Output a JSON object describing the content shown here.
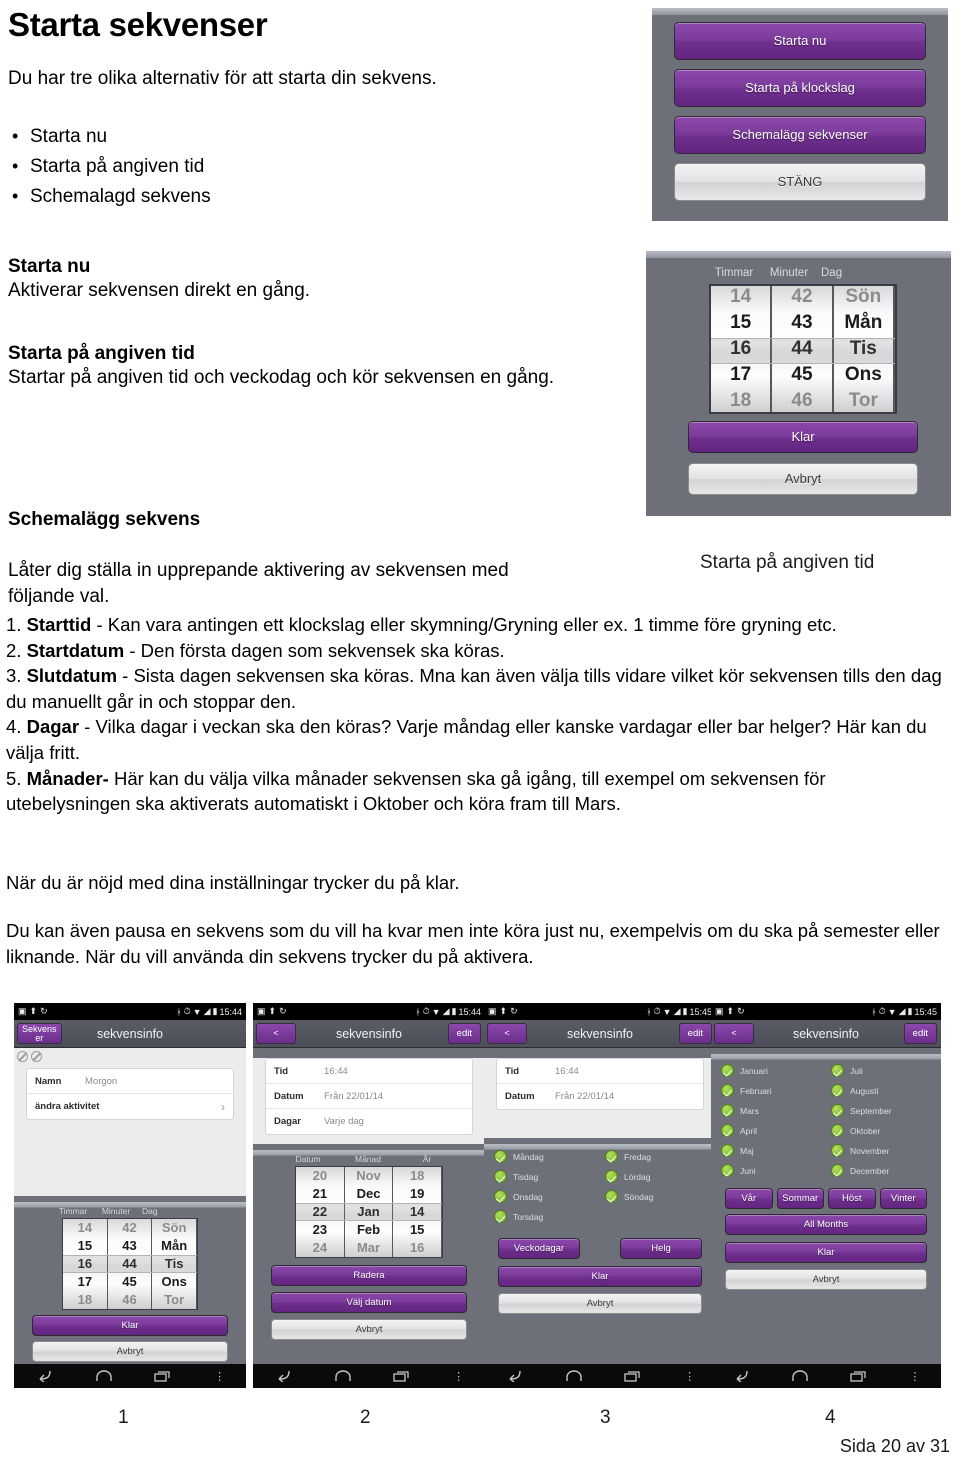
{
  "document": {
    "title": "Starta sekvenser",
    "intro": "Du har tre olika alternativ för att starta din sekvens.",
    "bullets": [
      "Starta nu",
      "Starta på angiven tid",
      "Schemalagd sekvens"
    ],
    "sections": [
      {
        "title": "Starta nu",
        "body": "Aktiverar sekvensen direkt en gång."
      },
      {
        "title": "Starta på angiven tid",
        "body": "Startar på angiven tid och veckodag och kör sekvensen en gång."
      },
      {
        "title": "Schemalägg sekvens",
        "body": "Låter dig ställa in upprepande aktivering av sekvensen med följande val."
      }
    ],
    "numbered": [
      {
        "n": "1.",
        "term": "Starttid",
        "text": " - Kan vara antingen ett klockslag eller skymning/Gryning eller ex. 1 timme före gryning etc."
      },
      {
        "n": "2.",
        "term": "Startdatum",
        "text": " - Den första dagen som sekvensek ska köras."
      },
      {
        "n": "3.",
        "term": "Slutdatum",
        "text": " - Sista dagen sekvensen ska köras. Mna kan även välja tills vidare vilket kör sekvensen tills den dag du manuellt går in och stoppar den."
      },
      {
        "n": "4.",
        "term": "Dagar",
        "text": " - Vilka dagar i veckan ska den köras? Varje måndag eller kanske vardagar eller bar helger? Här kan du välja fritt."
      },
      {
        "n": "5.",
        "term": "Månader-",
        "text": "  Här kan du välja vilka månader sekvensen ska gå igång, till exempel om sekvensen för utebelysningen ska aktiverats automatiskt i Oktober och köra fram till Mars."
      }
    ],
    "paragraph1": "När du är nöjd med dina inställningar trycker du på klar.",
    "paragraph2": "Du kan även pausa en sekvens som du vill ha kvar men inte köra just nu, exempelvis om du ska på semester eller liknande. När du vill använda din sekvens trycker du på aktivera.",
    "page_footer": "Sida 20 av 31",
    "figure_numbers": [
      "1",
      "2",
      "3",
      "4"
    ]
  },
  "dialog_start": {
    "buttons": [
      {
        "label": "Starta nu",
        "style": "purple"
      },
      {
        "label": "Starta på klockslag",
        "style": "purple"
      },
      {
        "label": "Schemalägg sekvenser",
        "style": "purple"
      },
      {
        "label": "STÄNG",
        "style": "grey"
      }
    ]
  },
  "dialog_time": {
    "column_labels": [
      "Timmar",
      "Minuter",
      "Dag"
    ],
    "hours": [
      "14",
      "15",
      "16",
      "17",
      "18"
    ],
    "minutes": [
      "42",
      "43",
      "44",
      "45",
      "46"
    ],
    "days": [
      "Sön",
      "Mån",
      "Tis",
      "Ons",
      "Tor"
    ],
    "selected_index": 2,
    "done_label": "Klar",
    "cancel_label": "Avbryt"
  },
  "caption": "Starta på angiven tid",
  "colors": {
    "purple": "#7c3c9c",
    "purple_dark": "#63257f",
    "panel_grey": "#6d7078",
    "green_check": "#72b02a"
  },
  "phones": [
    {
      "status_time": "15:44",
      "back_label_line1": "Sekvens",
      "back_label_line2": "er",
      "title": "sekvensinfo",
      "form": [
        {
          "key": "Namn",
          "value": "Morgon"
        },
        {
          "key": "ändra aktivitet",
          "value": ""
        }
      ],
      "wheel": {
        "column_labels": [
          "Timmar",
          "Minuter",
          "Dag"
        ],
        "col1": [
          "14",
          "15",
          "16",
          "17",
          "18"
        ],
        "col2": [
          "42",
          "43",
          "44",
          "45",
          "46"
        ],
        "col3": [
          "Sön",
          "Mån",
          "Tis",
          "Ons",
          "Tor"
        ]
      },
      "buttons": [
        {
          "label": "Klar",
          "style": "purple"
        },
        {
          "label": "Avbryt",
          "style": "grey"
        }
      ]
    },
    {
      "status_time": "15:44",
      "back_label": "<",
      "title": "sekvensinfo",
      "edit_label": "edit",
      "form": [
        {
          "key": "Tid",
          "value": "16:44"
        },
        {
          "key": "Datum",
          "value": "Från 22/01/14"
        },
        {
          "key": "Dagar",
          "value": "Varje dag"
        }
      ],
      "wheel": {
        "column_labels": [
          "Datum",
          "Månad",
          "År"
        ],
        "col1": [
          "20",
          "21",
          "22",
          "23",
          "24"
        ],
        "col2": [
          "Nov",
          "Dec",
          "Jan",
          "Feb",
          "Mar"
        ],
        "col3": [
          "18",
          "19",
          "14",
          "15",
          "16"
        ]
      },
      "buttons": [
        {
          "label": "Radera",
          "style": "purple"
        },
        {
          "label": "Välj datum",
          "style": "purple"
        },
        {
          "label": "Avbryt",
          "style": "grey"
        }
      ]
    },
    {
      "status_time": "15:45",
      "back_label": "<",
      "title": "sekvensinfo",
      "edit_label": "edit",
      "form": [
        {
          "key": "Tid",
          "value": "16:44"
        },
        {
          "key": "Datum",
          "value": "Från 22/01/14"
        }
      ],
      "checkboxes": [
        "Måndag",
        "Fredag",
        "Tisdag",
        "Lördag",
        "Onsdag",
        "Söndag",
        "Torsdag",
        ""
      ],
      "preset_buttons": [
        {
          "label": "Veckodagar",
          "style": "purple"
        },
        {
          "label": "Helg",
          "style": "purple"
        }
      ],
      "buttons": [
        {
          "label": "Klar",
          "style": "purple"
        },
        {
          "label": "Avbryt",
          "style": "grey"
        }
      ]
    },
    {
      "status_time": "15:45",
      "back_label": "<",
      "title": "sekvensinfo",
      "edit_label": "edit",
      "checkboxes": [
        "Januari",
        "Juli",
        "Februari",
        "Augusti",
        "Mars",
        "September",
        "April",
        "Oktober",
        "Maj",
        "November",
        "Juni",
        "December"
      ],
      "season_buttons": [
        {
          "label": "Vår"
        },
        {
          "label": "Sommar"
        },
        {
          "label": "Höst"
        },
        {
          "label": "Vinter"
        }
      ],
      "all_months_label": "All Months",
      "buttons": [
        {
          "label": "Klar",
          "style": "purple"
        },
        {
          "label": "Avbryt",
          "style": "grey"
        }
      ]
    }
  ]
}
